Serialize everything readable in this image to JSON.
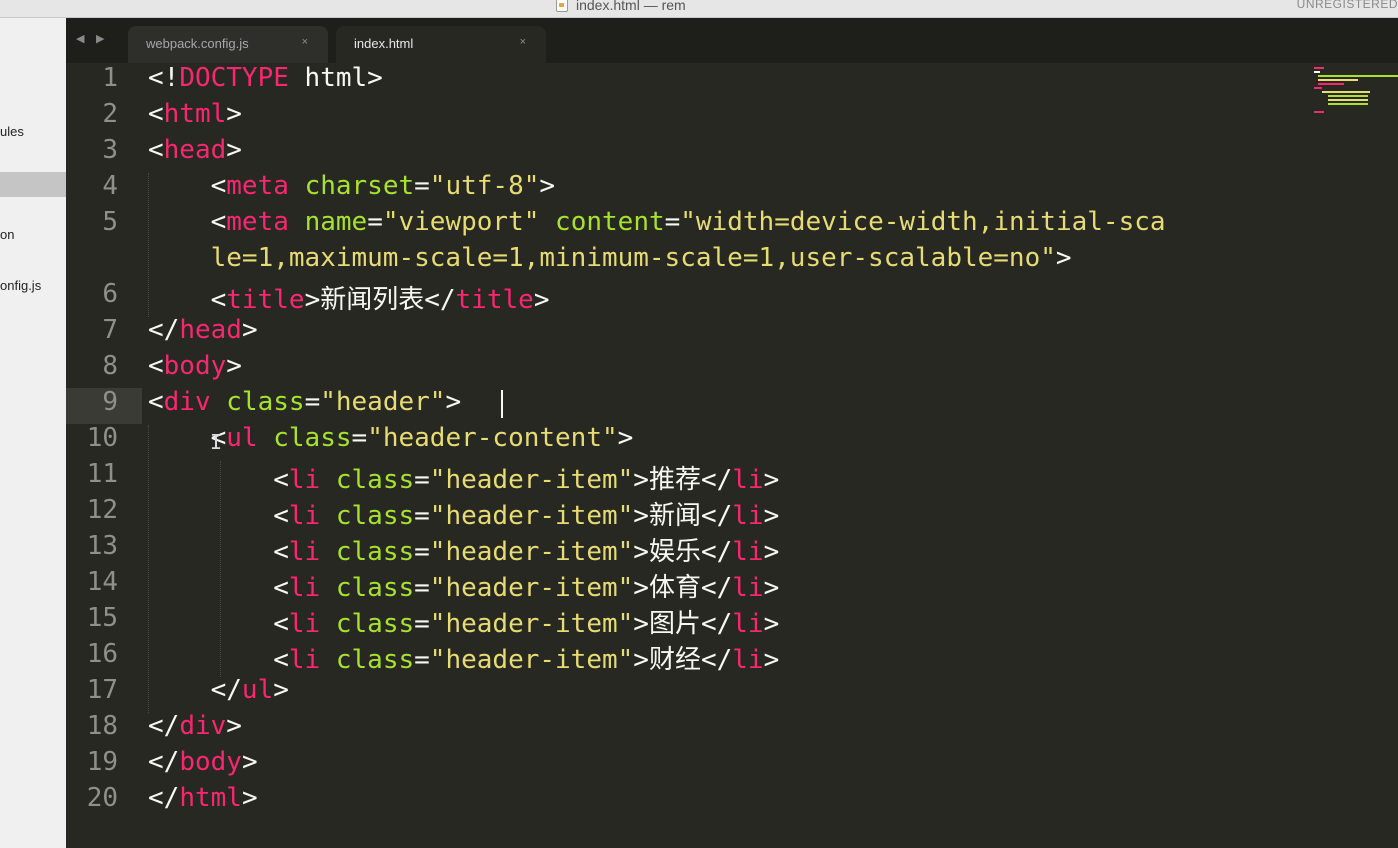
{
  "window": {
    "title": "index.html — rem",
    "license_notice": "UNREGISTERED"
  },
  "sidebar": {
    "items": [
      {
        "label": "ules"
      },
      {
        "label": "on"
      },
      {
        "label": "onfig.js"
      }
    ]
  },
  "tabs": [
    {
      "label": "webpack.config.js",
      "close": "×",
      "active": false
    },
    {
      "label": "index.html",
      "close": "×",
      "active": true
    }
  ],
  "nav": {
    "arrows": "◀ ▶"
  },
  "editor": {
    "current_line": 9,
    "lines": [
      {
        "n": "1",
        "tokens": [
          [
            "p",
            "<!"
          ],
          [
            "t",
            "DOCTYPE"
          ],
          [
            "p",
            " html>"
          ]
        ]
      },
      {
        "n": "2",
        "tokens": [
          [
            "p",
            "<"
          ],
          [
            "t",
            "html"
          ],
          [
            "p",
            ">"
          ]
        ]
      },
      {
        "n": "3",
        "tokens": [
          [
            "p",
            "<"
          ],
          [
            "t",
            "head"
          ],
          [
            "p",
            ">"
          ]
        ]
      },
      {
        "n": "4",
        "tokens": [
          [
            "p",
            "    <"
          ],
          [
            "t",
            "meta"
          ],
          [
            "p",
            " "
          ],
          [
            "a",
            "charset"
          ],
          [
            "p",
            "="
          ],
          [
            "s",
            "\"utf-8\""
          ],
          [
            "p",
            ">"
          ]
        ]
      },
      {
        "n": "5",
        "tokens": [
          [
            "p",
            "    <"
          ],
          [
            "t",
            "meta"
          ],
          [
            "p",
            " "
          ],
          [
            "a",
            "name"
          ],
          [
            "p",
            "="
          ],
          [
            "s",
            "\"viewport\""
          ],
          [
            "p",
            " "
          ],
          [
            "a",
            "content"
          ],
          [
            "p",
            "="
          ],
          [
            "s",
            "\"width=device-width,initial-sca"
          ]
        ]
      },
      {
        "n": "",
        "tokens": [
          [
            "s",
            "    le=1,maximum-scale=1,minimum-scale=1,user-scalable=no\""
          ],
          [
            "p",
            ">"
          ]
        ]
      },
      {
        "n": "6",
        "tokens": [
          [
            "p",
            "    <"
          ],
          [
            "t",
            "title"
          ],
          [
            "p",
            ">新闻列表</"
          ],
          [
            "t",
            "title"
          ],
          [
            "p",
            ">"
          ]
        ]
      },
      {
        "n": "7",
        "tokens": [
          [
            "p",
            "</"
          ],
          [
            "t",
            "head"
          ],
          [
            "p",
            ">"
          ]
        ]
      },
      {
        "n": "8",
        "tokens": [
          [
            "p",
            "<"
          ],
          [
            "t",
            "body"
          ],
          [
            "p",
            ">"
          ]
        ]
      },
      {
        "n": "9",
        "tokens": [
          [
            "p",
            "<"
          ],
          [
            "t",
            "div"
          ],
          [
            "p",
            " "
          ],
          [
            "a",
            "class"
          ],
          [
            "p",
            "="
          ],
          [
            "s",
            "\"header\""
          ],
          [
            "p",
            ">"
          ]
        ]
      },
      {
        "n": "10",
        "tokens": [
          [
            "p",
            "    <"
          ],
          [
            "t",
            "ul"
          ],
          [
            "p",
            " "
          ],
          [
            "a",
            "class"
          ],
          [
            "p",
            "="
          ],
          [
            "s",
            "\"header-content\""
          ],
          [
            "p",
            ">"
          ]
        ]
      },
      {
        "n": "11",
        "tokens": [
          [
            "p",
            "        <"
          ],
          [
            "t",
            "li"
          ],
          [
            "p",
            " "
          ],
          [
            "a",
            "class"
          ],
          [
            "p",
            "="
          ],
          [
            "s",
            "\"header-item\""
          ],
          [
            "p",
            ">推荐</"
          ],
          [
            "t",
            "li"
          ],
          [
            "p",
            ">"
          ]
        ]
      },
      {
        "n": "12",
        "tokens": [
          [
            "p",
            "        <"
          ],
          [
            "t",
            "li"
          ],
          [
            "p",
            " "
          ],
          [
            "a",
            "class"
          ],
          [
            "p",
            "="
          ],
          [
            "s",
            "\"header-item\""
          ],
          [
            "p",
            ">新闻</"
          ],
          [
            "t",
            "li"
          ],
          [
            "p",
            ">"
          ]
        ]
      },
      {
        "n": "13",
        "tokens": [
          [
            "p",
            "        <"
          ],
          [
            "t",
            "li"
          ],
          [
            "p",
            " "
          ],
          [
            "a",
            "class"
          ],
          [
            "p",
            "="
          ],
          [
            "s",
            "\"header-item\""
          ],
          [
            "p",
            ">娱乐</"
          ],
          [
            "t",
            "li"
          ],
          [
            "p",
            ">"
          ]
        ]
      },
      {
        "n": "14",
        "tokens": [
          [
            "p",
            "        <"
          ],
          [
            "t",
            "li"
          ],
          [
            "p",
            " "
          ],
          [
            "a",
            "class"
          ],
          [
            "p",
            "="
          ],
          [
            "s",
            "\"header-item\""
          ],
          [
            "p",
            ">体育</"
          ],
          [
            "t",
            "li"
          ],
          [
            "p",
            ">"
          ]
        ]
      },
      {
        "n": "15",
        "tokens": [
          [
            "p",
            "        <"
          ],
          [
            "t",
            "li"
          ],
          [
            "p",
            " "
          ],
          [
            "a",
            "class"
          ],
          [
            "p",
            "="
          ],
          [
            "s",
            "\"header-item\""
          ],
          [
            "p",
            ">图片</"
          ],
          [
            "t",
            "li"
          ],
          [
            "p",
            ">"
          ]
        ]
      },
      {
        "n": "16",
        "tokens": [
          [
            "p",
            "        <"
          ],
          [
            "t",
            "li"
          ],
          [
            "p",
            " "
          ],
          [
            "a",
            "class"
          ],
          [
            "p",
            "="
          ],
          [
            "s",
            "\"header-item\""
          ],
          [
            "p",
            ">财经</"
          ],
          [
            "t",
            "li"
          ],
          [
            "p",
            ">"
          ]
        ]
      },
      {
        "n": "17",
        "tokens": [
          [
            "p",
            "    </"
          ],
          [
            "t",
            "ul"
          ],
          [
            "p",
            ">"
          ]
        ]
      },
      {
        "n": "18",
        "tokens": [
          [
            "p",
            "</"
          ],
          [
            "t",
            "div"
          ],
          [
            "p",
            ">"
          ]
        ]
      },
      {
        "n": "19",
        "tokens": [
          [
            "p",
            "</"
          ],
          [
            "t",
            "body"
          ],
          [
            "p",
            ">"
          ]
        ]
      },
      {
        "n": "20",
        "tokens": [
          [
            "p",
            "</"
          ],
          [
            "t",
            "html"
          ],
          [
            "p",
            ">"
          ]
        ]
      }
    ]
  },
  "colors": {
    "background": "#272822",
    "tag": "#f92672",
    "attribute": "#a6e22e",
    "string": "#e6db74",
    "plain": "#f8f8f2",
    "gutter": "#8f908a"
  }
}
